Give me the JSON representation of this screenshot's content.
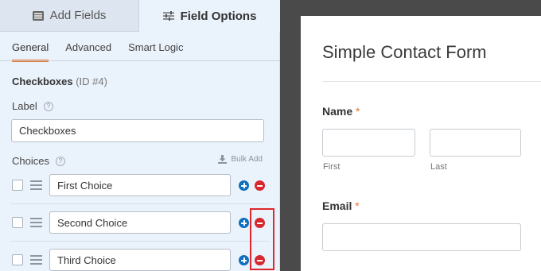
{
  "tabs": {
    "add_fields": "Add Fields",
    "field_options": "Field Options"
  },
  "subtabs": [
    "General",
    "Advanced",
    "Smart Logic"
  ],
  "field": {
    "title": "Checkboxes",
    "id_text": "(ID #4)",
    "label_caption": "Label",
    "label_value": "Checkboxes",
    "choices_caption": "Choices",
    "bulk_add": "Bulk Add",
    "choices": [
      {
        "value": "First Choice"
      },
      {
        "value": "Second Choice"
      },
      {
        "value": "Third Choice"
      }
    ]
  },
  "preview": {
    "form_title": "Simple Contact Form",
    "name_label": "Name",
    "required_mark": "*",
    "first_sub": "First",
    "last_sub": "Last",
    "email_label": "Email"
  },
  "colors": {
    "accent_orange": "#e27730",
    "add_blue": "#0e6fc0",
    "remove_red": "#d6282e",
    "highlight": "#e0262b"
  }
}
